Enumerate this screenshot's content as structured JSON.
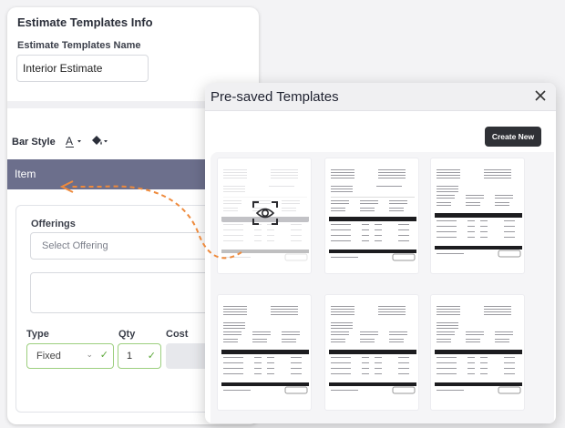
{
  "estimate_info": {
    "title": "Estimate Templates Info",
    "name_label": "Estimate Templates Name",
    "name_value": "Interior Estimate"
  },
  "toolbar": {
    "bar_style_label": "Bar Style",
    "font_color_icon": "font-color-icon",
    "fill_color_icon": "paint-bucket-icon"
  },
  "item_header": {
    "label": "Item"
  },
  "offerings": {
    "label": "Offerings",
    "select_placeholder": "Select Offering",
    "type_label": "Type",
    "type_value": "Fixed",
    "qty_label": "Qty",
    "qty_value": "1",
    "cost_label": "Cost"
  },
  "modal": {
    "title": "Pre-saved Templates",
    "close_icon": "close-icon",
    "create_button": "Create New"
  },
  "templates": [
    {
      "id": "t1",
      "hovered": true,
      "layout": "A"
    },
    {
      "id": "t2",
      "hovered": false,
      "layout": "A"
    },
    {
      "id": "t3",
      "hovered": false,
      "layout": "B"
    },
    {
      "id": "t4",
      "hovered": false,
      "layout": "C"
    },
    {
      "id": "t5",
      "hovered": false,
      "layout": "C"
    },
    {
      "id": "t6",
      "hovered": false,
      "layout": "B"
    }
  ],
  "colors": {
    "item_header_bg": "#6c6f8c",
    "arrow": "#ee8a3c",
    "valid_border": "#9ccf7e",
    "button_dark": "#2f3136"
  }
}
